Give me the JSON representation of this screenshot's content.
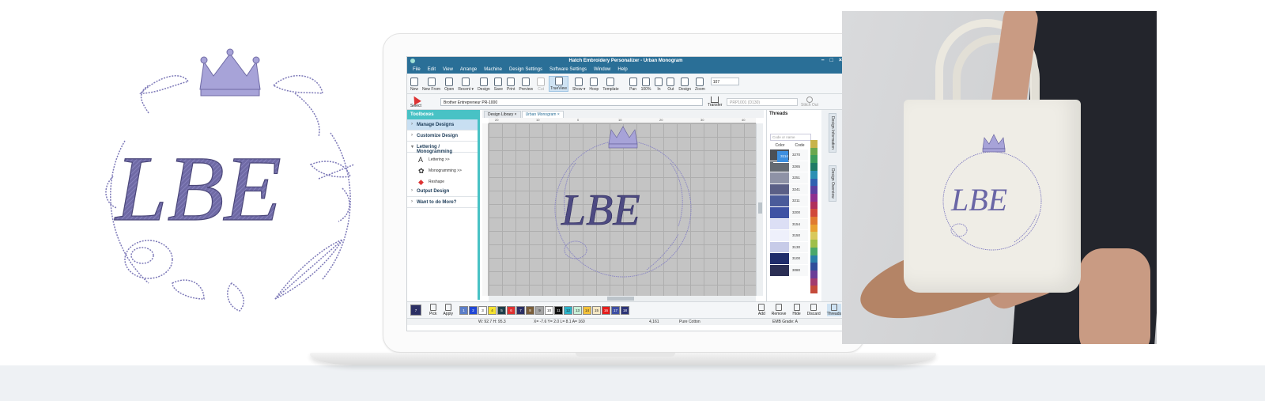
{
  "monogram": {
    "letters": "LBE",
    "thread_color": "#7d79b8",
    "crown_color": "#a7a3d8"
  },
  "app": {
    "title": "Hatch Embroidery Personalizer - Urban Monogram",
    "menu": [
      "File",
      "Edit",
      "View",
      "Arrange",
      "Machine",
      "Design Settings",
      "Software Settings",
      "Window",
      "Help"
    ],
    "toolbar": [
      "New",
      "New From",
      "Open",
      "Recent ▾",
      "Design",
      "Save",
      "Print",
      "Preview",
      "Cut",
      "TrueView",
      "Show ▾",
      "Hoop",
      "Template",
      "Pan",
      "100%",
      "In",
      "Out",
      "Design",
      "Zoom"
    ],
    "zoom_value": "107",
    "select_label": "Select",
    "machine": "Brother Entrepreneur PR-1000",
    "transfer_label": "Transfer",
    "hoop": "PRP1001 (D130)",
    "stitch_out": "Stitch Out",
    "toolboxes_title": "Toolboxes",
    "toolboxes": {
      "manage": "Manage Designs",
      "customize": "Customize Design",
      "lettering_mono": "Lettering / Monogramming",
      "lettering": "Lettering >>",
      "monogramming": "Monogramming >>",
      "reshape": "Reshape",
      "output": "Output Design",
      "more": "Want to do More?"
    },
    "tabs": [
      "Design Library",
      "Urban Monogram"
    ],
    "threads": {
      "title": "Threads",
      "search_placeholder": "Code or name",
      "col_color": "Color",
      "col_code": "Code",
      "rows": [
        {
          "code": "3270",
          "color": "#4b5057"
        },
        {
          "code": "3265",
          "color": "#646a72"
        },
        {
          "code": "3251",
          "color": "#8e92a6"
        },
        {
          "code": "3241",
          "color": "#5a5f86"
        },
        {
          "code": "3211",
          "color": "#4a5b9a"
        },
        {
          "code": "3200",
          "color": "#3e52a3"
        },
        {
          "code": "3154",
          "color": "#dcdff5"
        },
        {
          "code": "3150",
          "color": "#eef0fb"
        },
        {
          "code": "3130",
          "color": "#c7cbe8"
        },
        {
          "code": "3114",
          "color": "#233a8a"
        },
        {
          "code": "3100",
          "color": "#1f2c6b"
        },
        {
          "code": "3080",
          "color": "#2b2f55"
        }
      ],
      "selected": "3114"
    },
    "side_tabs": [
      "Design Information",
      "Design Overview"
    ],
    "color_chips": [
      {
        "n": "1",
        "c": "#5b7ec9"
      },
      {
        "n": "2",
        "c": "#2046d6"
      },
      {
        "n": "3",
        "c": "#ffffff"
      },
      {
        "n": "4",
        "c": "#f5e230"
      },
      {
        "n": "5",
        "c": "#1d3e4a"
      },
      {
        "n": "6",
        "c": "#e03030"
      },
      {
        "n": "7",
        "c": "#2b2f64"
      },
      {
        "n": "8",
        "c": "#7a5e3a"
      },
      {
        "n": "9",
        "c": "#a5a5a5"
      },
      {
        "n": "10",
        "c": "#ffffff"
      },
      {
        "n": "11",
        "c": "#111111"
      },
      {
        "n": "12",
        "c": "#2bb3c9"
      },
      {
        "n": "13",
        "c": "#c8f0d8"
      },
      {
        "n": "14",
        "c": "#f4c23a"
      },
      {
        "n": "15",
        "c": "#f5e7c4"
      },
      {
        "n": "16",
        "c": "#e61c1c"
      },
      {
        "n": "17",
        "c": "#3d4ea3"
      },
      {
        "n": "18",
        "c": "#2c3477"
      }
    ],
    "current_color": {
      "n": "7",
      "c": "#2b2f64"
    },
    "pick_label": "Pick",
    "apply_label": "Apply",
    "add_label": "Add",
    "remove_label": "Remove",
    "hide_label": "Hide",
    "discard_label": "Discard",
    "threads_label": "Threads",
    "status": {
      "size": "W: 92.7 H: 95.3",
      "coords": "X= -7.6 Y= 2.0 L= 8.1 A= 160",
      "stitches": "4,161",
      "thread_brand": "Pure Cotton",
      "emb_grade": "EMB Grade: A"
    },
    "ruler_ticks": [
      "20",
      "10",
      "0",
      "10",
      "20",
      "30",
      "40"
    ]
  }
}
